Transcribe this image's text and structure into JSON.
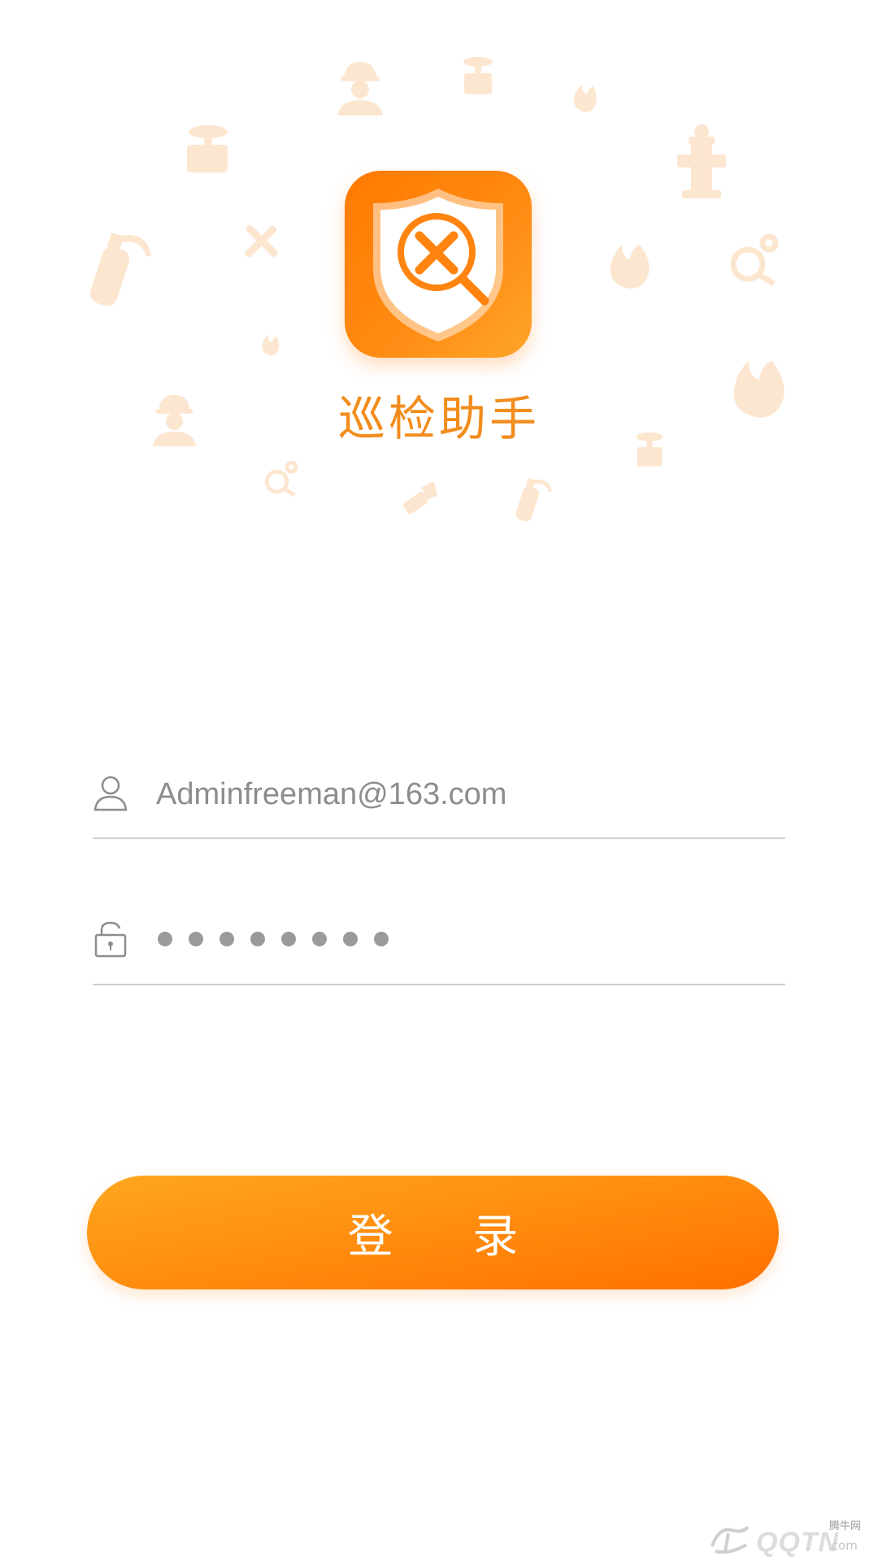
{
  "app": {
    "name": "巡检助手"
  },
  "login_form": {
    "username_value": "Adminfreeman@163.com",
    "password_mask_count": 8,
    "login_label": "登 录"
  },
  "watermark": {
    "small": "腾牛网",
    "big": "QQTN",
    "suffix": ".com"
  },
  "colors": {
    "accent": "#ff8a12",
    "title": "#f28c1c",
    "decoration": "#fde6cf"
  }
}
